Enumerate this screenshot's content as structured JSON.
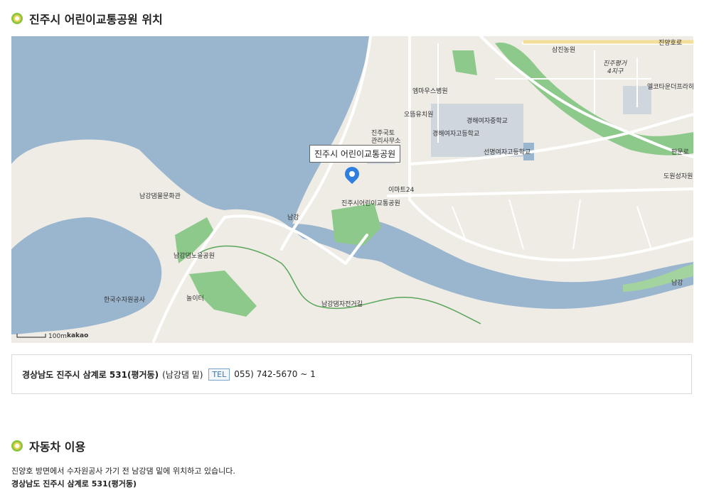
{
  "location_section": {
    "title": "진주시 어린이교통공원 위치"
  },
  "map": {
    "marker_label": "진주시 어린이교통공원",
    "places": {
      "samjin": "삼진농원",
      "jinju_pyeongeo": "진주평거",
      "district4": "4지구",
      "mmaus": "엠마우스병원",
      "ottum": "오뜸유치원",
      "gyeonghae_high": "경해여자고등학교",
      "gyeonghae_mid": "경해여자중학교",
      "kukto1": "진주국토",
      "kukto2": "관리사무소",
      "seonmyeong": "선명여자고등학교",
      "emart": "이마트24",
      "park_name": "진주시어린이교통공원",
      "namgang_dam_museum": "남강댐물문화관",
      "namgang_noeul": "남강댐노을공원",
      "kwater": "한국수자원공사",
      "playground": "놀이터",
      "elcotown": "엘코타운더프라하아파트",
      "dowon": "도원성자원운전전문",
      "river": "남강",
      "river_small": "남강",
      "road1": "진양호로",
      "road2": "판문로",
      "trail": "남강댐자전거길",
      "scale": "100m",
      "brand": "kakao"
    },
    "colors": {
      "water": "#9ab6cf",
      "land": "#efece6",
      "park": "#8cc98a",
      "road": "#ffffff",
      "marker": "#2f7fe0"
    }
  },
  "address": {
    "main": "경상남도 진주시 삼계로 531(평거동)",
    "note": "(남강댐 밑)",
    "tel_label": "TEL",
    "tel_number": "055) 742-5670 ~ 1"
  },
  "car_section": {
    "title": "자동차 이용",
    "description": "진양호 방면에서 수자원공사 가기 전 남강댐 밑에 위치하고 있습니다.",
    "address": "경상남도 진주시 삼계로 531(평거동)"
  }
}
